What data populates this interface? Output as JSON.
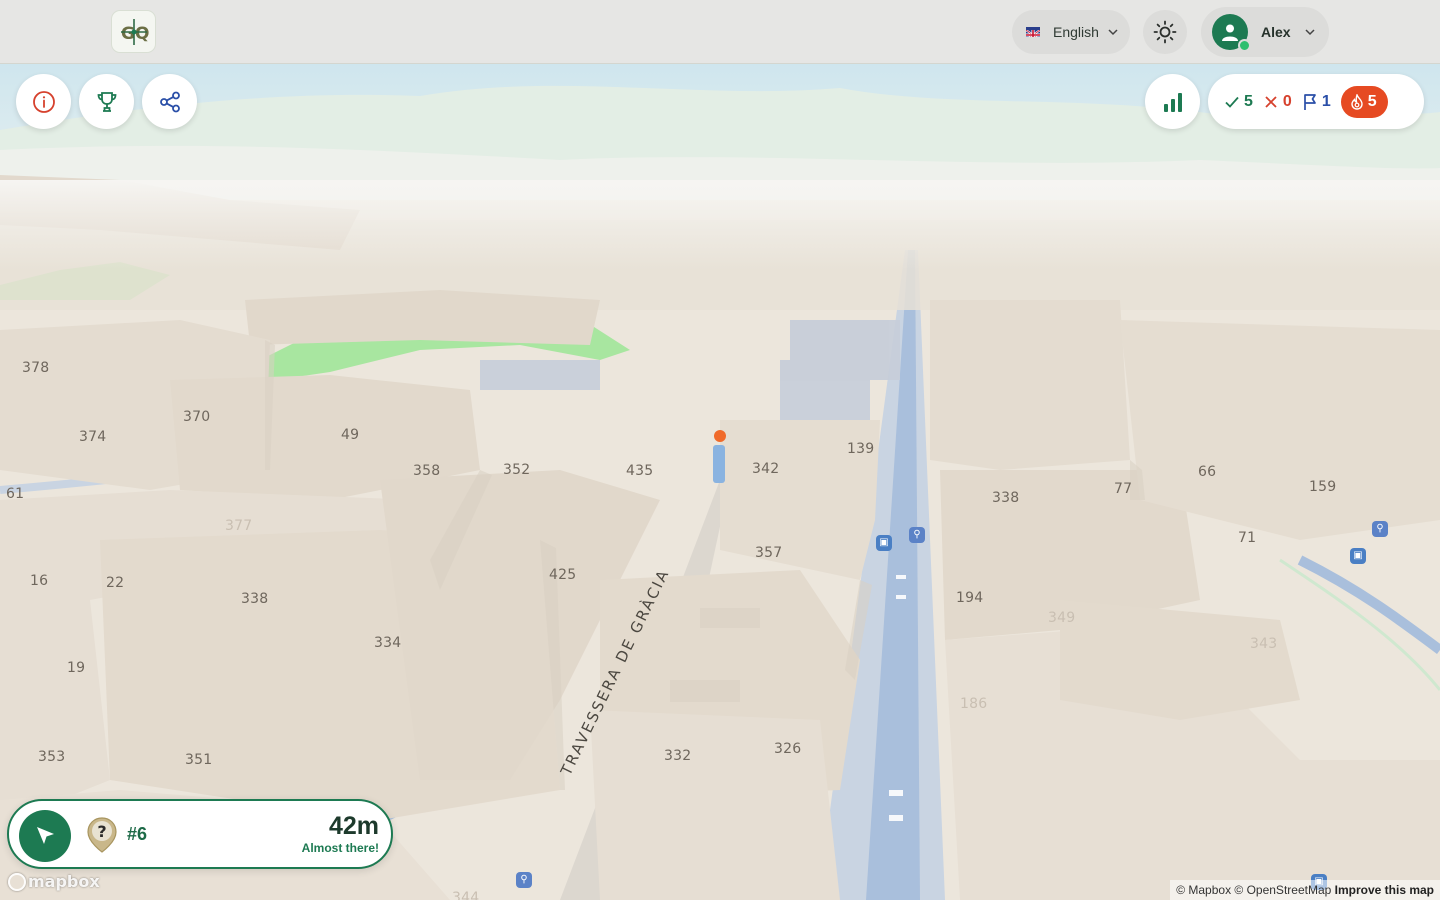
{
  "header": {
    "logo_text": "GQ",
    "language": "English",
    "user_name": "Alex"
  },
  "stats": {
    "correct": "5",
    "wrong": "0",
    "flagged": "1",
    "streak": "5"
  },
  "navigation": {
    "number": "#6",
    "distance": "42m",
    "message": "Almost there!"
  },
  "map": {
    "street_name": "TRAVESSERA DE GRÀCIA",
    "labels": [
      "378",
      "370",
      "374",
      "49",
      "358",
      "352",
      "435",
      "342",
      "139",
      "61",
      "377",
      "425",
      "357",
      "16",
      "22",
      "338",
      "334",
      "19",
      "353",
      "351",
      "332",
      "326",
      "66",
      "77",
      "159",
      "338",
      "71",
      "194",
      "349",
      "343",
      "186",
      "344"
    ],
    "mapbox_logo": "mapbox",
    "attribution": "© Mapbox © OpenStreetMap",
    "improve_link": "Improve this map"
  },
  "colors": {
    "brand_green": "#1d7a52",
    "error_red": "#d6412d",
    "flag_blue": "#2a4fa8",
    "streak_orange": "#e64a22",
    "building": "#e6ded3",
    "park": "#a8e6a0",
    "road_blue": "#a9bfdc"
  },
  "icons": {
    "info": "info-icon",
    "leaderboard": "trophy-icon",
    "share": "share-icon",
    "stats": "bar-chart-icon",
    "theme": "sun-icon",
    "navigate": "navigation-arrow-icon",
    "unknown_place": "question-marker-icon"
  }
}
